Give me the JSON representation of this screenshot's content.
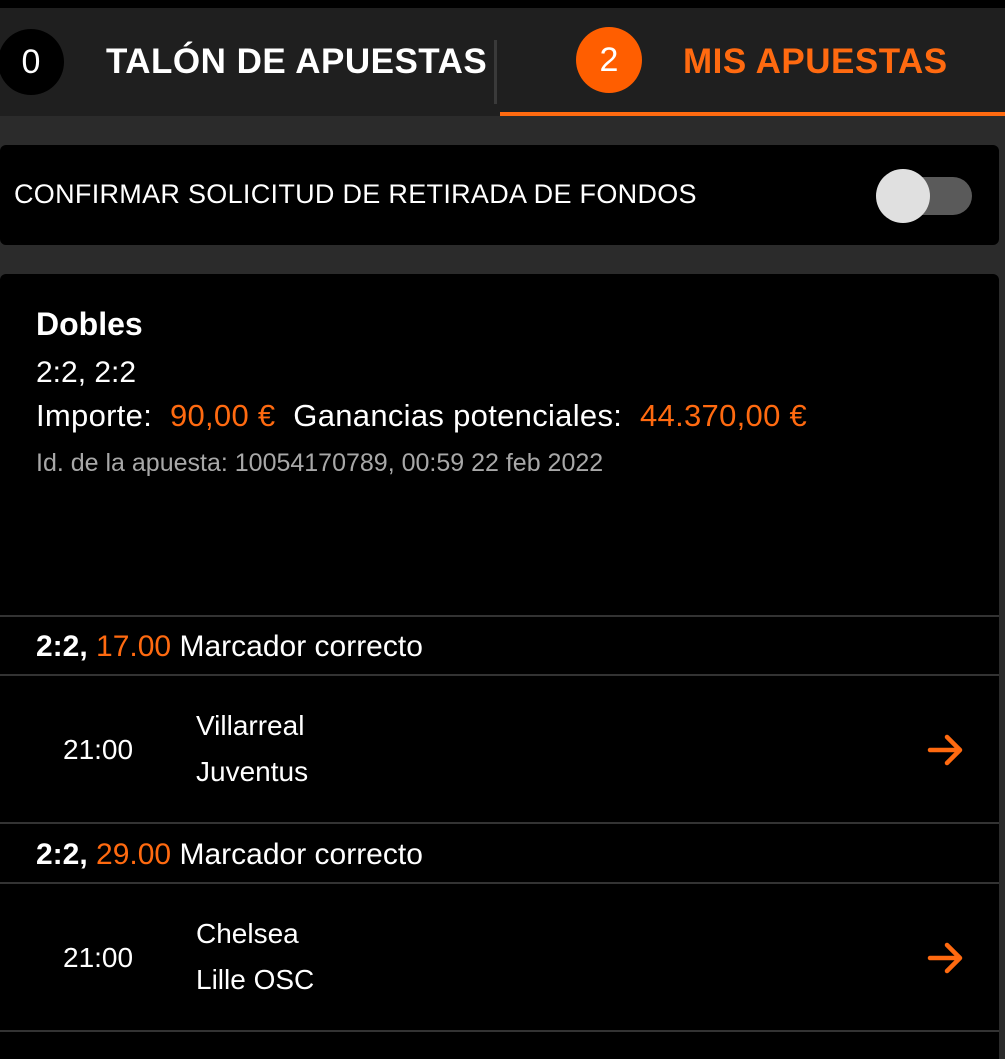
{
  "tabs": {
    "betslip": {
      "count": "0",
      "label": "TALÓN DE APUESTAS"
    },
    "mybets": {
      "count": "2",
      "label": "MIS APUESTAS"
    }
  },
  "cashout_confirm": {
    "label": "CONFIRMAR SOLICITUD DE RETIRADA DE FONDOS",
    "enabled": false
  },
  "bet": {
    "type": "Dobles",
    "picks": "2:2, 2:2",
    "stake_label": "Importe:",
    "stake_value": "90,00 €",
    "potential_label": "Ganancias potenciales:",
    "potential_value": "44.370,00 €",
    "bet_id_line": "Id. de la apuesta: 10054170789, 00:59 22 feb 2022"
  },
  "selections": [
    {
      "score": "2:2,",
      "odds": "17.00",
      "market": "Marcador correcto",
      "time": "21:00",
      "home": "Villarreal",
      "away": "Juventus"
    },
    {
      "score": "2:2,",
      "odds": "29.00",
      "market": "Marcador correcto",
      "time": "21:00",
      "home": "Chelsea",
      "away": "Lille OSC"
    }
  ],
  "colors": {
    "accent": "#ff6a10",
    "background": "#2b2b2b",
    "card": "#000000"
  },
  "icons": {
    "arrow": "arrow-right-icon"
  }
}
